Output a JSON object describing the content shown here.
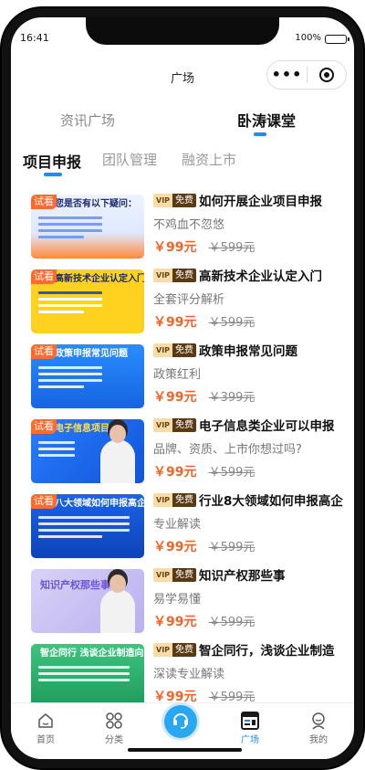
{
  "status_bar": {
    "time": "16:41",
    "battery": "100%"
  },
  "nav": {
    "title": "广场",
    "more_icon": "more-dots-icon",
    "target_icon": "target-icon"
  },
  "top_tabs": [
    {
      "label": "资讯广场",
      "active": false
    },
    {
      "label": "卧涛课堂",
      "active": true
    }
  ],
  "sub_tabs": [
    {
      "label": "项目申报",
      "active": true
    },
    {
      "label": "团队管理",
      "active": false
    },
    {
      "label": "融资上市",
      "active": false
    }
  ],
  "badges": {
    "trial": "试看",
    "vip": "VIP",
    "free": "免费"
  },
  "courses": [
    {
      "thumb_text": "您是否有以下疑问：",
      "thumb_bg": "#eef3ff",
      "title": "如何开展企业项目申报",
      "subtitle": "不鸡血不忽悠",
      "price": "￥99元",
      "old_price": "￥599元"
    },
    {
      "thumb_text": "高新技术企业认定入门到精通",
      "thumb_bg": "#ffd21f",
      "title": "高新技术企业认定入门",
      "subtitle": "全套评分解析",
      "price": "￥99元",
      "old_price": "￥599元"
    },
    {
      "thumb_text": "政策申报常见问题",
      "thumb_bg": "#1f7bf0",
      "title": "政策申报常见问题",
      "subtitle": "政策红利",
      "price": "￥99元",
      "old_price": "￥399元"
    },
    {
      "thumb_text": "电子信息项目",
      "thumb_bg": "#1c6ff0",
      "title": "电子信息类企业可以申报",
      "subtitle": "品牌、资质、上市你想过吗?",
      "price": "￥99元",
      "old_price": "￥599元"
    },
    {
      "thumb_text": "八大领域如何申报高企",
      "thumb_bg": "#1557d6",
      "title": "行业8大领域如何申报高企",
      "subtitle": "专业解读",
      "price": "￥99元",
      "old_price": "￥599元"
    },
    {
      "thumb_text": "知识产权那些事",
      "thumb_bg": "#c9c3f0",
      "title": "知识产权那些事",
      "subtitle": "易学易懂",
      "price": "￥99元",
      "old_price": "￥599元"
    },
    {
      "thumb_text": "智企同行 浅谈企业制造向“新”力",
      "thumb_bg": "#2fb472",
      "title": "智企同行，浅谈企业制造",
      "subtitle": "深读专业解读",
      "price": "￥99元",
      "old_price": "￥599元"
    }
  ],
  "tabbar": [
    {
      "label": "首页",
      "icon": "home-icon",
      "active": false
    },
    {
      "label": "分类",
      "icon": "category-icon",
      "active": false
    },
    {
      "label": "",
      "icon": "customer-service-icon",
      "active": false
    },
    {
      "label": "广场",
      "icon": "plaza-icon",
      "active": true
    },
    {
      "label": "我的",
      "icon": "profile-icon",
      "active": false
    }
  ],
  "colors": {
    "accent": "#1e8cf0",
    "price": "#f2652a",
    "trial": "#ff6a2d",
    "center_button": "#29a7f0"
  }
}
